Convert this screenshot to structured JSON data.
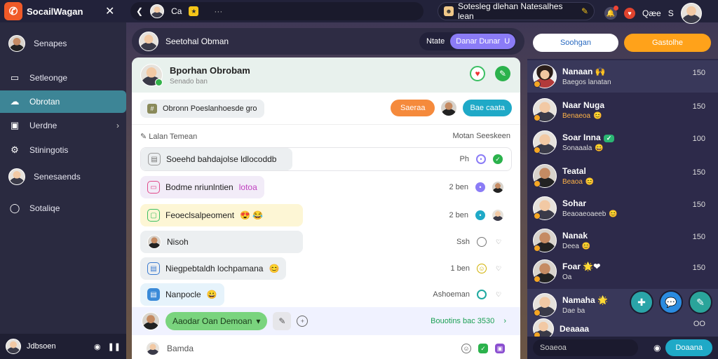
{
  "app": {
    "brand": "SocailWagan",
    "logo": "social-logo-icon"
  },
  "topbar": {
    "chat_title": "Ca",
    "more": "···",
    "search_text": "Sotesleg dlehan Natesalhes lean",
    "user_name": "Qæe",
    "user_status": "S",
    "icons": [
      "back-icon",
      "sticker-icon",
      "bell-icon",
      "flame-icon"
    ]
  },
  "sidebar": {
    "profile_label": "Senapes",
    "items": [
      {
        "label": "Setleonge",
        "icon": "folder-icon"
      },
      {
        "label": "Obrotan",
        "icon": "chat-icon",
        "active": true
      },
      {
        "label": "Uerdne",
        "icon": "contacts-icon",
        "chevron": "›"
      },
      {
        "label": "Stiningotis",
        "icon": "settings-icon"
      },
      {
        "label": "Senesaends",
        "icon": "avatar"
      },
      {
        "label": "Sotaliqe",
        "icon": "circle-icon"
      }
    ],
    "footer": {
      "label": "Jdbsoen"
    }
  },
  "center": {
    "header_name": "Seetohal Obman",
    "pill_label": "Ntate",
    "pill_button": "Danar Dunar",
    "pill_button_icon": "U",
    "chat": {
      "name": "Bporhan Obrobam",
      "subtitle": "Senado ban",
      "filter_chip": "Obronn Poeslanhoesde gro",
      "btn_orange": "Saeraa",
      "btn_blue": "Bae caata",
      "list_title": "Lalan Temean",
      "list_right": "Motan Seeskeen"
    },
    "messages": [
      {
        "text": "Soeehd bahdajolse ldlocoddb",
        "time": "Ph",
        "bg": "#eceff1",
        "icon": "note-icon"
      },
      {
        "text": "Bodme nriunlntien",
        "tag": "lotoa",
        "time": "2 ben",
        "bg": "#f2ecf8",
        "icon": "bookmark-icon"
      },
      {
        "text": "Feoeclsalpeoment",
        "emoji": "😍 😂",
        "time": "2 ben",
        "bg": "#fdf6d5",
        "icon": "square-icon"
      },
      {
        "text": "Nisoh",
        "time": "Ssh",
        "bg": "#eceff1",
        "icon": "avatar"
      },
      {
        "text": "Niegpebtaldh lochpamana",
        "emoji": "😊",
        "time": "1 ben",
        "bg": "#eceff1",
        "icon": "doc-icon"
      },
      {
        "text": "Nanpocle",
        "emoji": "😀",
        "time": "Ashoeman",
        "bg": "#e6f3fb",
        "icon": "file-icon"
      }
    ],
    "compose": {
      "pill": "Aaodar Oan Demoan",
      "link": "Bouotins bac 3530"
    },
    "input_placeholder": "Bamda"
  },
  "right": {
    "tab1": "Soohgan",
    "tab2": "Gastolhe",
    "contacts": [
      {
        "name": "Nanaan",
        "emoji": "🙌",
        "sub": "Baegos lanatan",
        "time": "150"
      },
      {
        "name": "Naar Nuga",
        "sub": "Benaeoa",
        "sub_orange": true,
        "time": "150"
      },
      {
        "name": "Soar Inna",
        "badge": "✓",
        "sub": "Sonaaala",
        "time": "100"
      },
      {
        "name": "Teatal",
        "sub": "Beaoa",
        "sub_orange": true,
        "time": "150"
      },
      {
        "name": "Sohar",
        "sub": "Beaoaeoaeeb",
        "time": "150"
      },
      {
        "name": "Nanak",
        "sub": "Deea",
        "time": "150"
      },
      {
        "name": "Foar",
        "emoji": "🌟❤",
        "sub": "Oa",
        "time": "150"
      },
      {
        "name": "Namaha",
        "emoji": "🌟",
        "sub": "Dae ba",
        "time": ""
      },
      {
        "name": "Deaaaa",
        "sub": "",
        "time": "OO"
      }
    ],
    "fabs": [
      "plus-icon",
      "chat-bubble-icon",
      "new-chat-icon"
    ],
    "fab_colors": [
      "#2aa4a8",
      "#2a8be0",
      "#2aa49a"
    ],
    "send_placeholder": "Soaeoa",
    "send_button": "Doaana"
  },
  "colors": {
    "active": "#3d8596",
    "orange": "#f58a3c",
    "blue": "#1fa9c7",
    "purple": "#8b7cf6"
  }
}
